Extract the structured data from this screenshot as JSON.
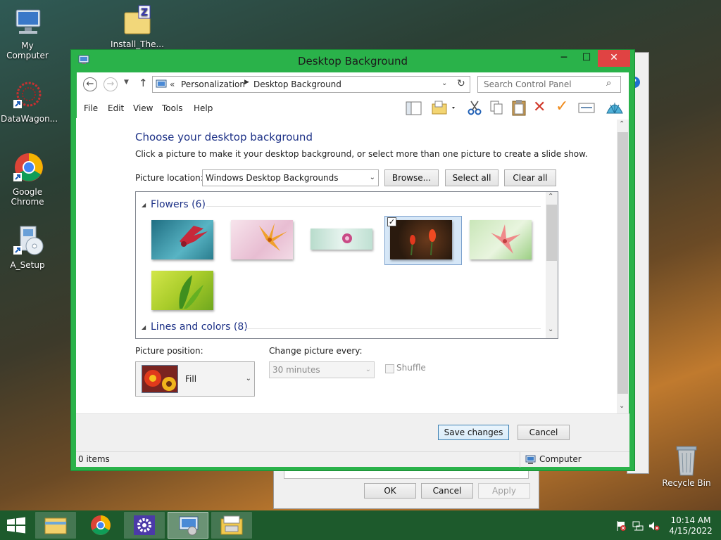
{
  "desktop": {
    "icons": [
      {
        "label": "My Computer"
      },
      {
        "label": "Install_The..."
      },
      {
        "label": "DataWagon..."
      },
      {
        "label": "Google Chrome"
      },
      {
        "label": "A_Setup"
      },
      {
        "label": "Recycle Bin"
      }
    ]
  },
  "background_dialog": {
    "ok": "OK",
    "cancel": "Cancel",
    "apply": "Apply"
  },
  "window": {
    "title": "Desktop Background",
    "breadcrumb": {
      "prefix": "«",
      "parent": "Personalization",
      "current": "Desktop Background"
    },
    "search_placeholder": "Search Control Panel",
    "menu": {
      "file": "File",
      "edit": "Edit",
      "view": "View",
      "tools": "Tools",
      "help": "Help"
    },
    "heading": "Choose your desktop background",
    "subheading": "Click a picture to make it your desktop background, or select more than one picture to create a slide show.",
    "picture_location_label": "Picture location:",
    "picture_location_value": "Windows Desktop Backgrounds",
    "browse": "Browse...",
    "select_all": "Select all",
    "clear_all": "Clear all",
    "groups": [
      {
        "label": "Flowers (6)"
      },
      {
        "label": "Lines and colors (8)"
      }
    ],
    "picture_position_label": "Picture position:",
    "picture_position_value": "Fill",
    "change_every_label": "Change picture every:",
    "change_every_value": "30 minutes",
    "shuffle_label": "Shuffle",
    "save": "Save changes",
    "cancel": "Cancel",
    "status_items": "0 items",
    "status_location": "Computer"
  },
  "taskbar": {
    "time": "10:14 AM",
    "date": "4/15/2022"
  }
}
